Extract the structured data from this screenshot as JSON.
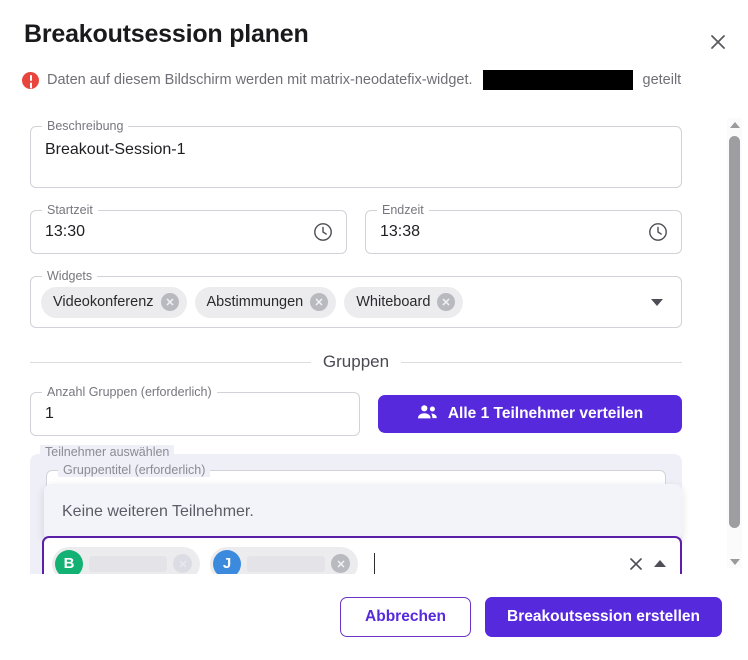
{
  "dialog": {
    "title": "Breakoutsession planen",
    "close_icon": "close-icon",
    "notice": {
      "icon": "error-circle-icon",
      "text_before": "Daten auf diesem Bildschirm werden mit matrix-neodatefix-widget.",
      "redacted": "",
      "text_after": "geteilt"
    }
  },
  "form": {
    "description": {
      "label": "Beschreibung",
      "value": "Breakout-Session-1",
      "placeholder": ""
    },
    "start_time": {
      "label": "Startzeit",
      "value": "13:30",
      "icon": "clock-icon"
    },
    "end_time": {
      "label": "Endzeit",
      "value": "13:38",
      "icon": "clock-icon"
    },
    "widgets": {
      "label": "Widgets",
      "chips": [
        {
          "label": "Videokonferenz",
          "remove_icon": "remove-circle-icon"
        },
        {
          "label": "Abstimmungen",
          "remove_icon": "remove-circle-icon"
        },
        {
          "label": "Whiteboard",
          "remove_icon": "remove-circle-icon"
        }
      ],
      "expand_icon": "chevron-down-icon"
    }
  },
  "groups_section": {
    "heading": "Gruppen",
    "count": {
      "label": "Anzahl Gruppen (erforderlich)",
      "value": "1"
    },
    "distribute_button": {
      "label": "Alle 1 Teilnehmer verteilen",
      "icon": "people-icon"
    },
    "group_card": {
      "title_field": {
        "label": "Gruppentitel (erforderlich)",
        "value": ""
      },
      "dropdown_message": "Keine weiteren Teilnehmer.",
      "participants_field": {
        "label": "Teilnehmer auswählen",
        "chips": [
          {
            "initial": "B",
            "color": "#13b173",
            "name": "",
            "remove_icon": "remove-circle-icon"
          },
          {
            "initial": "J",
            "color": "#3c8ade",
            "name": "",
            "remove_icon": "remove-circle-icon"
          }
        ],
        "clear_icon": "close-icon",
        "collapse_icon": "chevron-up-icon"
      }
    }
  },
  "scrollbar": {
    "up_icon": "scroll-up-arrow-icon",
    "down_icon": "scroll-down-arrow-icon"
  },
  "footer": {
    "cancel_label": "Abbrechen",
    "submit_label": "Breakoutsession erstellen"
  },
  "colors": {
    "primary": "#5729dd",
    "focus_outline": "#5b1fa8",
    "error": "#e8453c",
    "panel_bg": "#eeeff7",
    "avatar_green": "#13b173",
    "avatar_blue": "#3c8ade"
  }
}
